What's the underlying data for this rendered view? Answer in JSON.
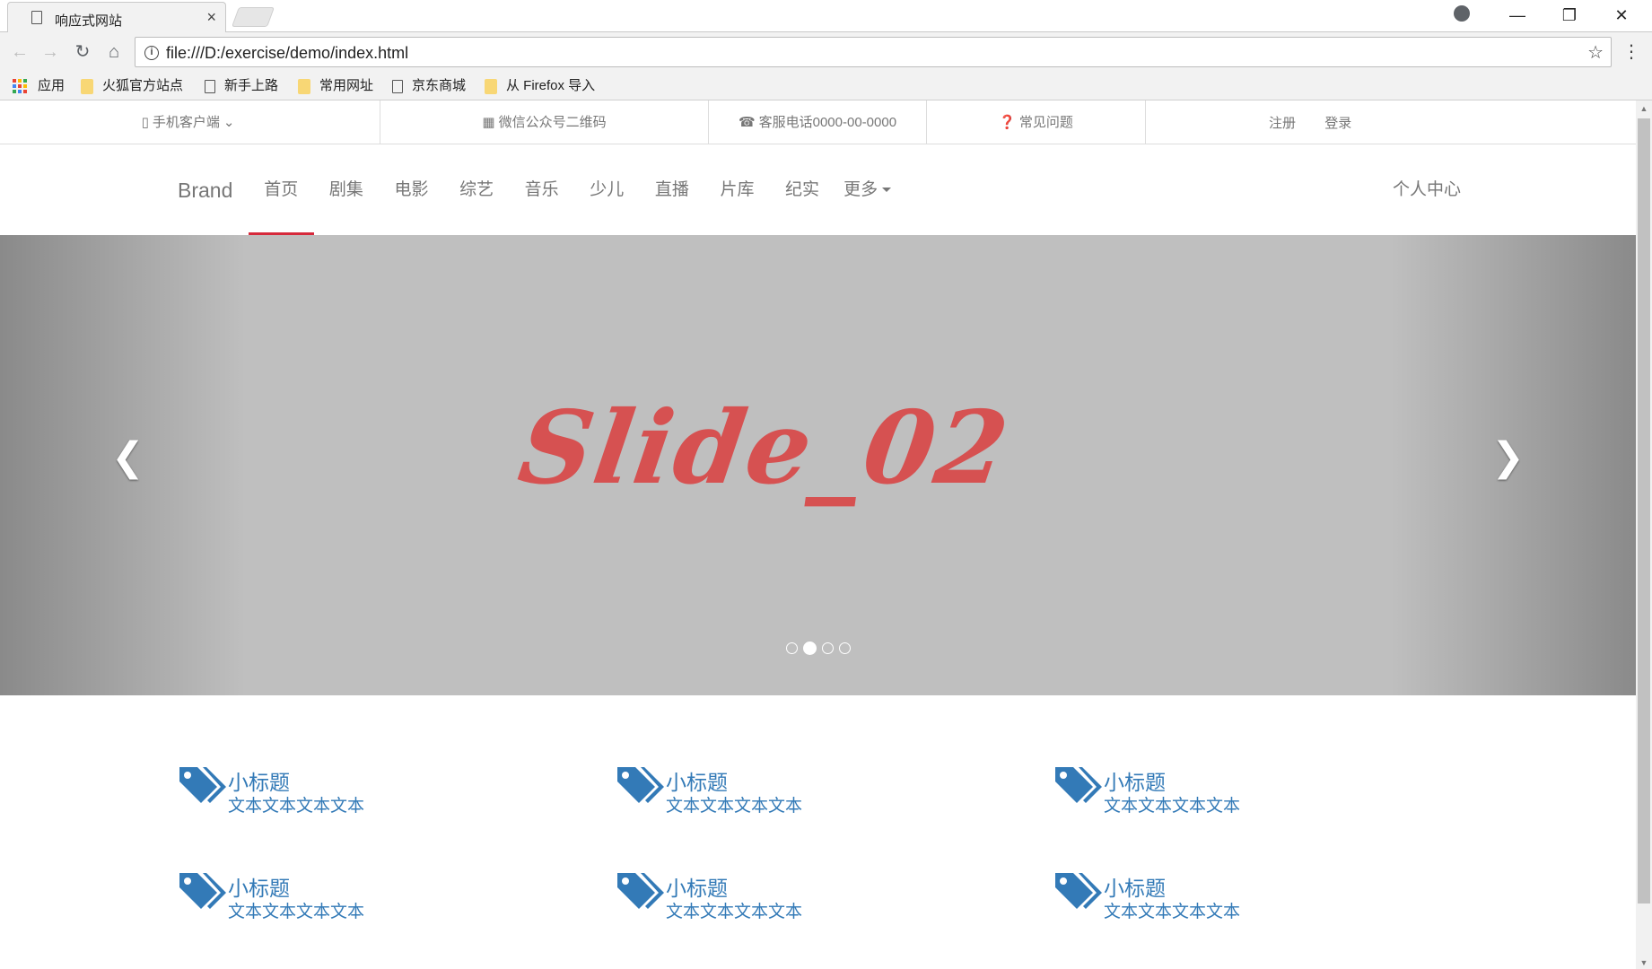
{
  "browser": {
    "tab_title": "响应式网站",
    "tab_close": "×",
    "url": "file:///D:/exercise/demo/index.html",
    "star": "☆",
    "menu": "⋮",
    "back": "←",
    "forward": "→",
    "reload": "↻",
    "home": "⌂",
    "win_min": "—",
    "win_restore": "❐",
    "win_close": "✕"
  },
  "bookmarks": {
    "apps": "应用",
    "items": [
      {
        "label": "火狐官方站点",
        "icon": "folder-icon"
      },
      {
        "label": "新手上路",
        "icon": "page-icon"
      },
      {
        "label": "常用网址",
        "icon": "folder-icon"
      },
      {
        "label": "京东商城",
        "icon": "page-icon"
      },
      {
        "label": "从 Firefox 导入",
        "icon": "folder-icon"
      }
    ]
  },
  "topbar": {
    "mobile": "手机客户端",
    "wechat": "微信公众号二维码",
    "phone": "客服电话0000-00-0000",
    "faq": "常见问题",
    "register": "注册",
    "login": "登录"
  },
  "nav": {
    "brand": "Brand",
    "items": [
      "首页",
      "剧集",
      "电影",
      "综艺",
      "音乐",
      "少儿",
      "直播",
      "片库",
      "纪实"
    ],
    "more": "更多",
    "personal": "个人中心",
    "active_index": 0
  },
  "carousel": {
    "slide_text": "Slide_02",
    "prev": "‹",
    "next": "›",
    "slide_count": 4,
    "active_slide": 1
  },
  "features": [
    {
      "title": "小标题",
      "text": "文本文本文本文本"
    },
    {
      "title": "小标题",
      "text": "文本文本文本文本"
    },
    {
      "title": "小标题",
      "text": "文本文本文本文本"
    },
    {
      "title": "小标题",
      "text": "文本文本文本文本"
    },
    {
      "title": "小标题",
      "text": "文本文本文本文本"
    },
    {
      "title": "小标题",
      "text": "文本文本文本文本"
    }
  ],
  "colors": {
    "accent_red": "#d6293b",
    "link_blue": "#337ab7",
    "slide_bg": "#bfbfbf",
    "slide_text": "#d65151"
  }
}
